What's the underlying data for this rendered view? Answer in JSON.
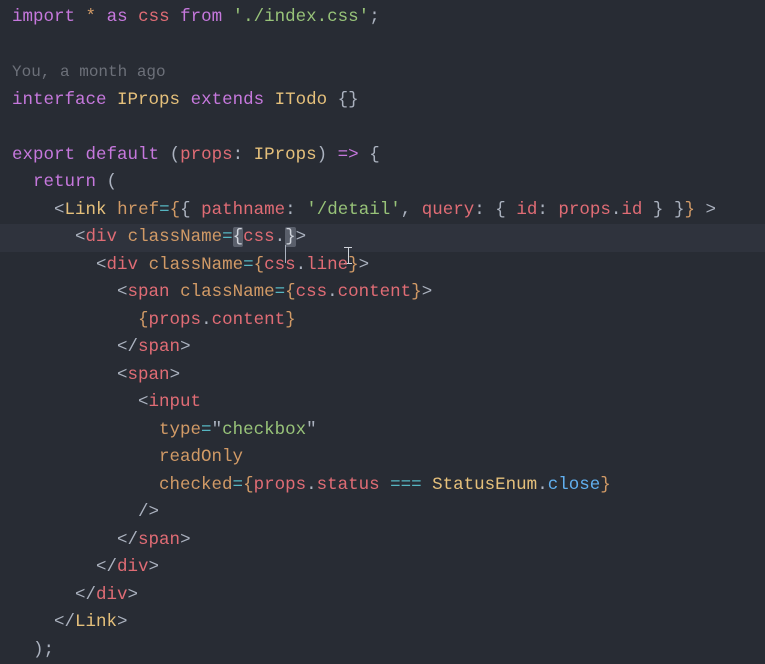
{
  "lines": {
    "l1": {
      "import": "import",
      "star": "*",
      "as": "as",
      "css": "css",
      "from": "from",
      "path": "'./index.css'",
      "semi": ";"
    },
    "blank1": "",
    "blame": "You, a month ago",
    "l_iface": {
      "interface": "interface",
      "name": "IProps",
      "extends": "extends",
      "base": "ITodo",
      "body": "{}"
    },
    "blank2": "",
    "l_exp": {
      "export": "export",
      "default": "default",
      "lp": "(",
      "arg": "props",
      "colon": ":",
      "type": "IProps",
      "rp": ")",
      "arrow": "=>",
      "ob": "{"
    },
    "l_ret": {
      "return": "return",
      "lp": "("
    },
    "l_link": {
      "tag": "Link",
      "href": "href",
      "eq": "=",
      "ob": "{",
      "ocb": "{",
      "pathname": "pathname",
      "colon1": ":",
      "str": "'/detail'",
      "comma": ",",
      "query": "query",
      "colon2": ":",
      "ocb2": "{",
      "id": "id",
      "colon3": ":",
      "props": "props",
      "dot": ".",
      "idprop": "id",
      "ccb2": "}",
      "ccb": "}",
      "cb": "}",
      "gt": ">"
    },
    "l_div1": {
      "tag": "div",
      "attr": "className",
      "eq": "=",
      "ob": "{",
      "css": "css",
      "dot": ".",
      "cb": "}",
      "gt": ">"
    },
    "l_div2": {
      "tag": "div",
      "attr": "className",
      "eq": "=",
      "ob": "{",
      "css": "css",
      "dot": ".",
      "cls": "line",
      "cb": "}",
      "gt": ">"
    },
    "l_span1": {
      "tag": "span",
      "attr": "className",
      "eq": "=",
      "ob": "{",
      "css": "css",
      "dot": ".",
      "cls": "content",
      "cb": "}",
      "gt": ">"
    },
    "l_content": {
      "ob": "{",
      "props": "props",
      "dot": ".",
      "prop": "content",
      "cb": "}"
    },
    "l_cspan": {
      "tag": "span"
    },
    "l_ospan": {
      "tag": "span",
      "gt": ">"
    },
    "l_input": {
      "tag": "input"
    },
    "l_type": {
      "attr": "type",
      "eq": "=",
      "q": "\"",
      "val": "checkbox",
      "q2": "\""
    },
    "l_readonly": {
      "attr": "readOnly"
    },
    "l_checked": {
      "attr": "checked",
      "eq": "=",
      "ob": "{",
      "props": "props",
      "dot": ".",
      "status": "status",
      "eqeqeq": "===",
      "enum": "StatusEnum",
      "dot2": ".",
      "close": "close",
      "cb": "}"
    },
    "l_selfclose": {
      "sc": "/>"
    },
    "l_cspan2": {
      "tag": "span"
    },
    "l_cdiv2": {
      "tag": "div"
    },
    "l_cdiv1": {
      "tag": "div"
    },
    "l_clink": {
      "tag": "Link"
    },
    "l_close": {
      "rp": ")",
      "semi": ";"
    }
  }
}
